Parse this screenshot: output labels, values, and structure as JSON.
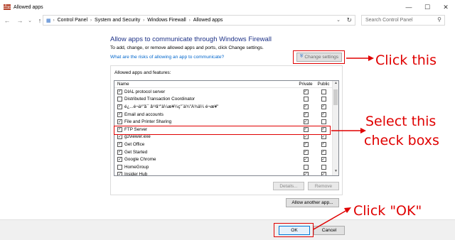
{
  "window": {
    "title": "Allowed apps"
  },
  "nav": {
    "back": "←",
    "forward": "→",
    "recent": "⌄",
    "up": "↑",
    "breadcrumb": [
      "Control Panel",
      "System and Security",
      "Windows Firewall",
      "Allowed apps"
    ],
    "search_placeholder": "Search Control Panel"
  },
  "main": {
    "heading": "Allow apps to communicate through Windows Firewall",
    "subtext": "To add, change, or remove allowed apps and ports, click Change settings.",
    "risk_link": "What are the risks of allowing an app to communicate?",
    "change_settings": "Change settings",
    "group_label": "Allowed apps and features:",
    "columns": {
      "name": "Name",
      "private": "Private",
      "public": "Public"
    },
    "apps": [
      {
        "name": "DIAL protocol server",
        "enabled": true,
        "private": true,
        "public": false
      },
      {
        "name": "Distributed Transaction Coordinator",
        "enabled": false,
        "private": false,
        "public": false
      },
      {
        "name": "é¿...é¬ä¹\"å¯ å¹³å°\"ä¼æ¥¼ç\"¨ä¾\"Â¾ä¼  é¬æ¥\"",
        "enabled": true,
        "private": true,
        "public": true
      },
      {
        "name": "Email and accounts",
        "enabled": true,
        "private": true,
        "public": true
      },
      {
        "name": "File and Printer Sharing",
        "enabled": true,
        "private": true,
        "public": false
      },
      {
        "name": "FTP Server",
        "enabled": true,
        "private": true,
        "public": true
      },
      {
        "name": "g2viewer.exe",
        "enabled": true,
        "private": true,
        "public": true
      },
      {
        "name": "Get Office",
        "enabled": true,
        "private": true,
        "public": true
      },
      {
        "name": "Get Started",
        "enabled": true,
        "private": true,
        "public": true
      },
      {
        "name": "Google Chrome",
        "enabled": true,
        "private": true,
        "public": true
      },
      {
        "name": "HomeGroup",
        "enabled": false,
        "private": false,
        "public": false
      },
      {
        "name": "Insider Hub",
        "enabled": true,
        "private": true,
        "public": true
      }
    ],
    "details": "Details...",
    "remove": "Remove",
    "allow_another": "Allow another app..."
  },
  "footer": {
    "ok": "OK",
    "cancel": "Cancel"
  },
  "annotations": {
    "click_this": "Click this",
    "select_line1": "Select this",
    "select_line2": "check boxs",
    "click_ok": "Click \"OK\""
  },
  "colors": {
    "annotation_red": "#e00000",
    "heading_blue": "#1e3287",
    "link_blue": "#0066cc"
  }
}
